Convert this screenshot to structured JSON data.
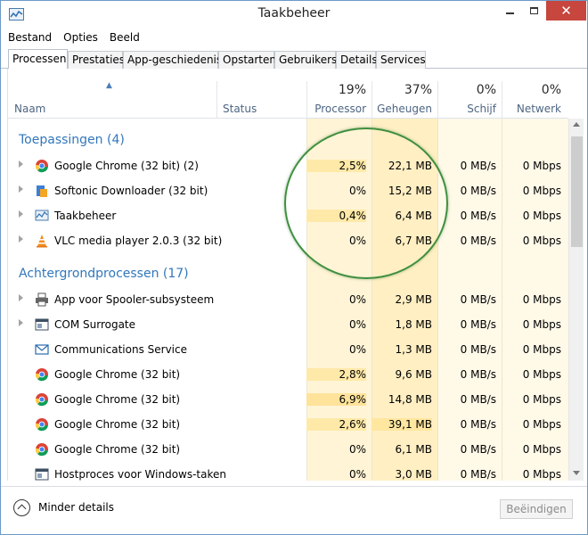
{
  "window": {
    "title": "Taakbeheer"
  },
  "menu": [
    "Bestand",
    "Opties",
    "Beeld"
  ],
  "tabs": [
    "Processen",
    "Prestaties",
    "App-geschiedenis",
    "Opstarten",
    "Gebruikers",
    "Details",
    "Services"
  ],
  "active_tab": "Processen",
  "columns": {
    "name": "Naam",
    "status": "Status",
    "cpu": {
      "label": "Processor",
      "total": "19%"
    },
    "memory": {
      "label": "Geheugen",
      "total": "37%"
    },
    "disk": {
      "label": "Schijf",
      "total": "0%"
    },
    "network": {
      "label": "Netwerk",
      "total": "0%"
    }
  },
  "groups": [
    {
      "title": "Toepassingen (4)",
      "rows": [
        {
          "icon": "chrome-icon",
          "name": "Google Chrome (32 bit) (2)",
          "expandable": true,
          "cpu": "2,5%",
          "mem": "22,1 MB",
          "disk": "0 MB/s",
          "net": "0 Mbps"
        },
        {
          "icon": "softonic-icon",
          "name": "Softonic Downloader (32 bit)",
          "expandable": true,
          "cpu": "0%",
          "mem": "15,2 MB",
          "disk": "0 MB/s",
          "net": "0 Mbps"
        },
        {
          "icon": "taskmanager-icon",
          "name": "Taakbeheer",
          "expandable": true,
          "cpu": "0,4%",
          "mem": "6,4 MB",
          "disk": "0 MB/s",
          "net": "0 Mbps"
        },
        {
          "icon": "vlc-icon",
          "name": "VLC media player 2.0.3 (32 bit)",
          "expandable": true,
          "cpu": "0%",
          "mem": "6,7 MB",
          "disk": "0 MB/s",
          "net": "0 Mbps"
        }
      ]
    },
    {
      "title": "Achtergrondprocessen (17)",
      "rows": [
        {
          "icon": "printer-icon",
          "name": "App voor Spooler-subsysteem",
          "expandable": true,
          "cpu": "0%",
          "mem": "2,9 MB",
          "disk": "0 MB/s",
          "net": "0 Mbps"
        },
        {
          "icon": "window-app-icon",
          "name": "COM Surrogate",
          "expandable": true,
          "cpu": "0%",
          "mem": "1,8 MB",
          "disk": "0 MB/s",
          "net": "0 Mbps"
        },
        {
          "icon": "mail-icon",
          "name": "Communications Service",
          "expandable": false,
          "cpu": "0%",
          "mem": "1,3 MB",
          "disk": "0 MB/s",
          "net": "0 Mbps"
        },
        {
          "icon": "chrome-icon",
          "name": "Google Chrome (32 bit)",
          "expandable": false,
          "cpu": "2,8%",
          "mem": "9,6 MB",
          "disk": "0 MB/s",
          "net": "0 Mbps"
        },
        {
          "icon": "chrome-icon",
          "name": "Google Chrome (32 bit)",
          "expandable": false,
          "cpu": "6,9%",
          "mem": "14,8 MB",
          "disk": "0 MB/s",
          "net": "0 Mbps"
        },
        {
          "icon": "chrome-icon",
          "name": "Google Chrome (32 bit)",
          "expandable": false,
          "cpu": "2,6%",
          "mem": "39,1 MB",
          "disk": "0 MB/s",
          "net": "0 Mbps"
        },
        {
          "icon": "chrome-icon",
          "name": "Google Chrome (32 bit)",
          "expandable": false,
          "cpu": "0%",
          "mem": "6,1 MB",
          "disk": "0 MB/s",
          "net": "0 Mbps"
        },
        {
          "icon": "window-app-icon",
          "name": "Hostproces voor Windows-taken",
          "expandable": false,
          "cpu": "0%",
          "mem": "3,0 MB",
          "disk": "0 MB/s",
          "net": "0 Mbps"
        }
      ]
    }
  ],
  "footer": {
    "less_details": "Minder details",
    "end_task": "Beëindigen"
  },
  "colors": {
    "accent": "#3277bb",
    "heat_light": "#fff4d6",
    "heat_mid": "#ffefc3",
    "heat_high": "#ffe9a8",
    "annotation": "#3f8f3f"
  }
}
